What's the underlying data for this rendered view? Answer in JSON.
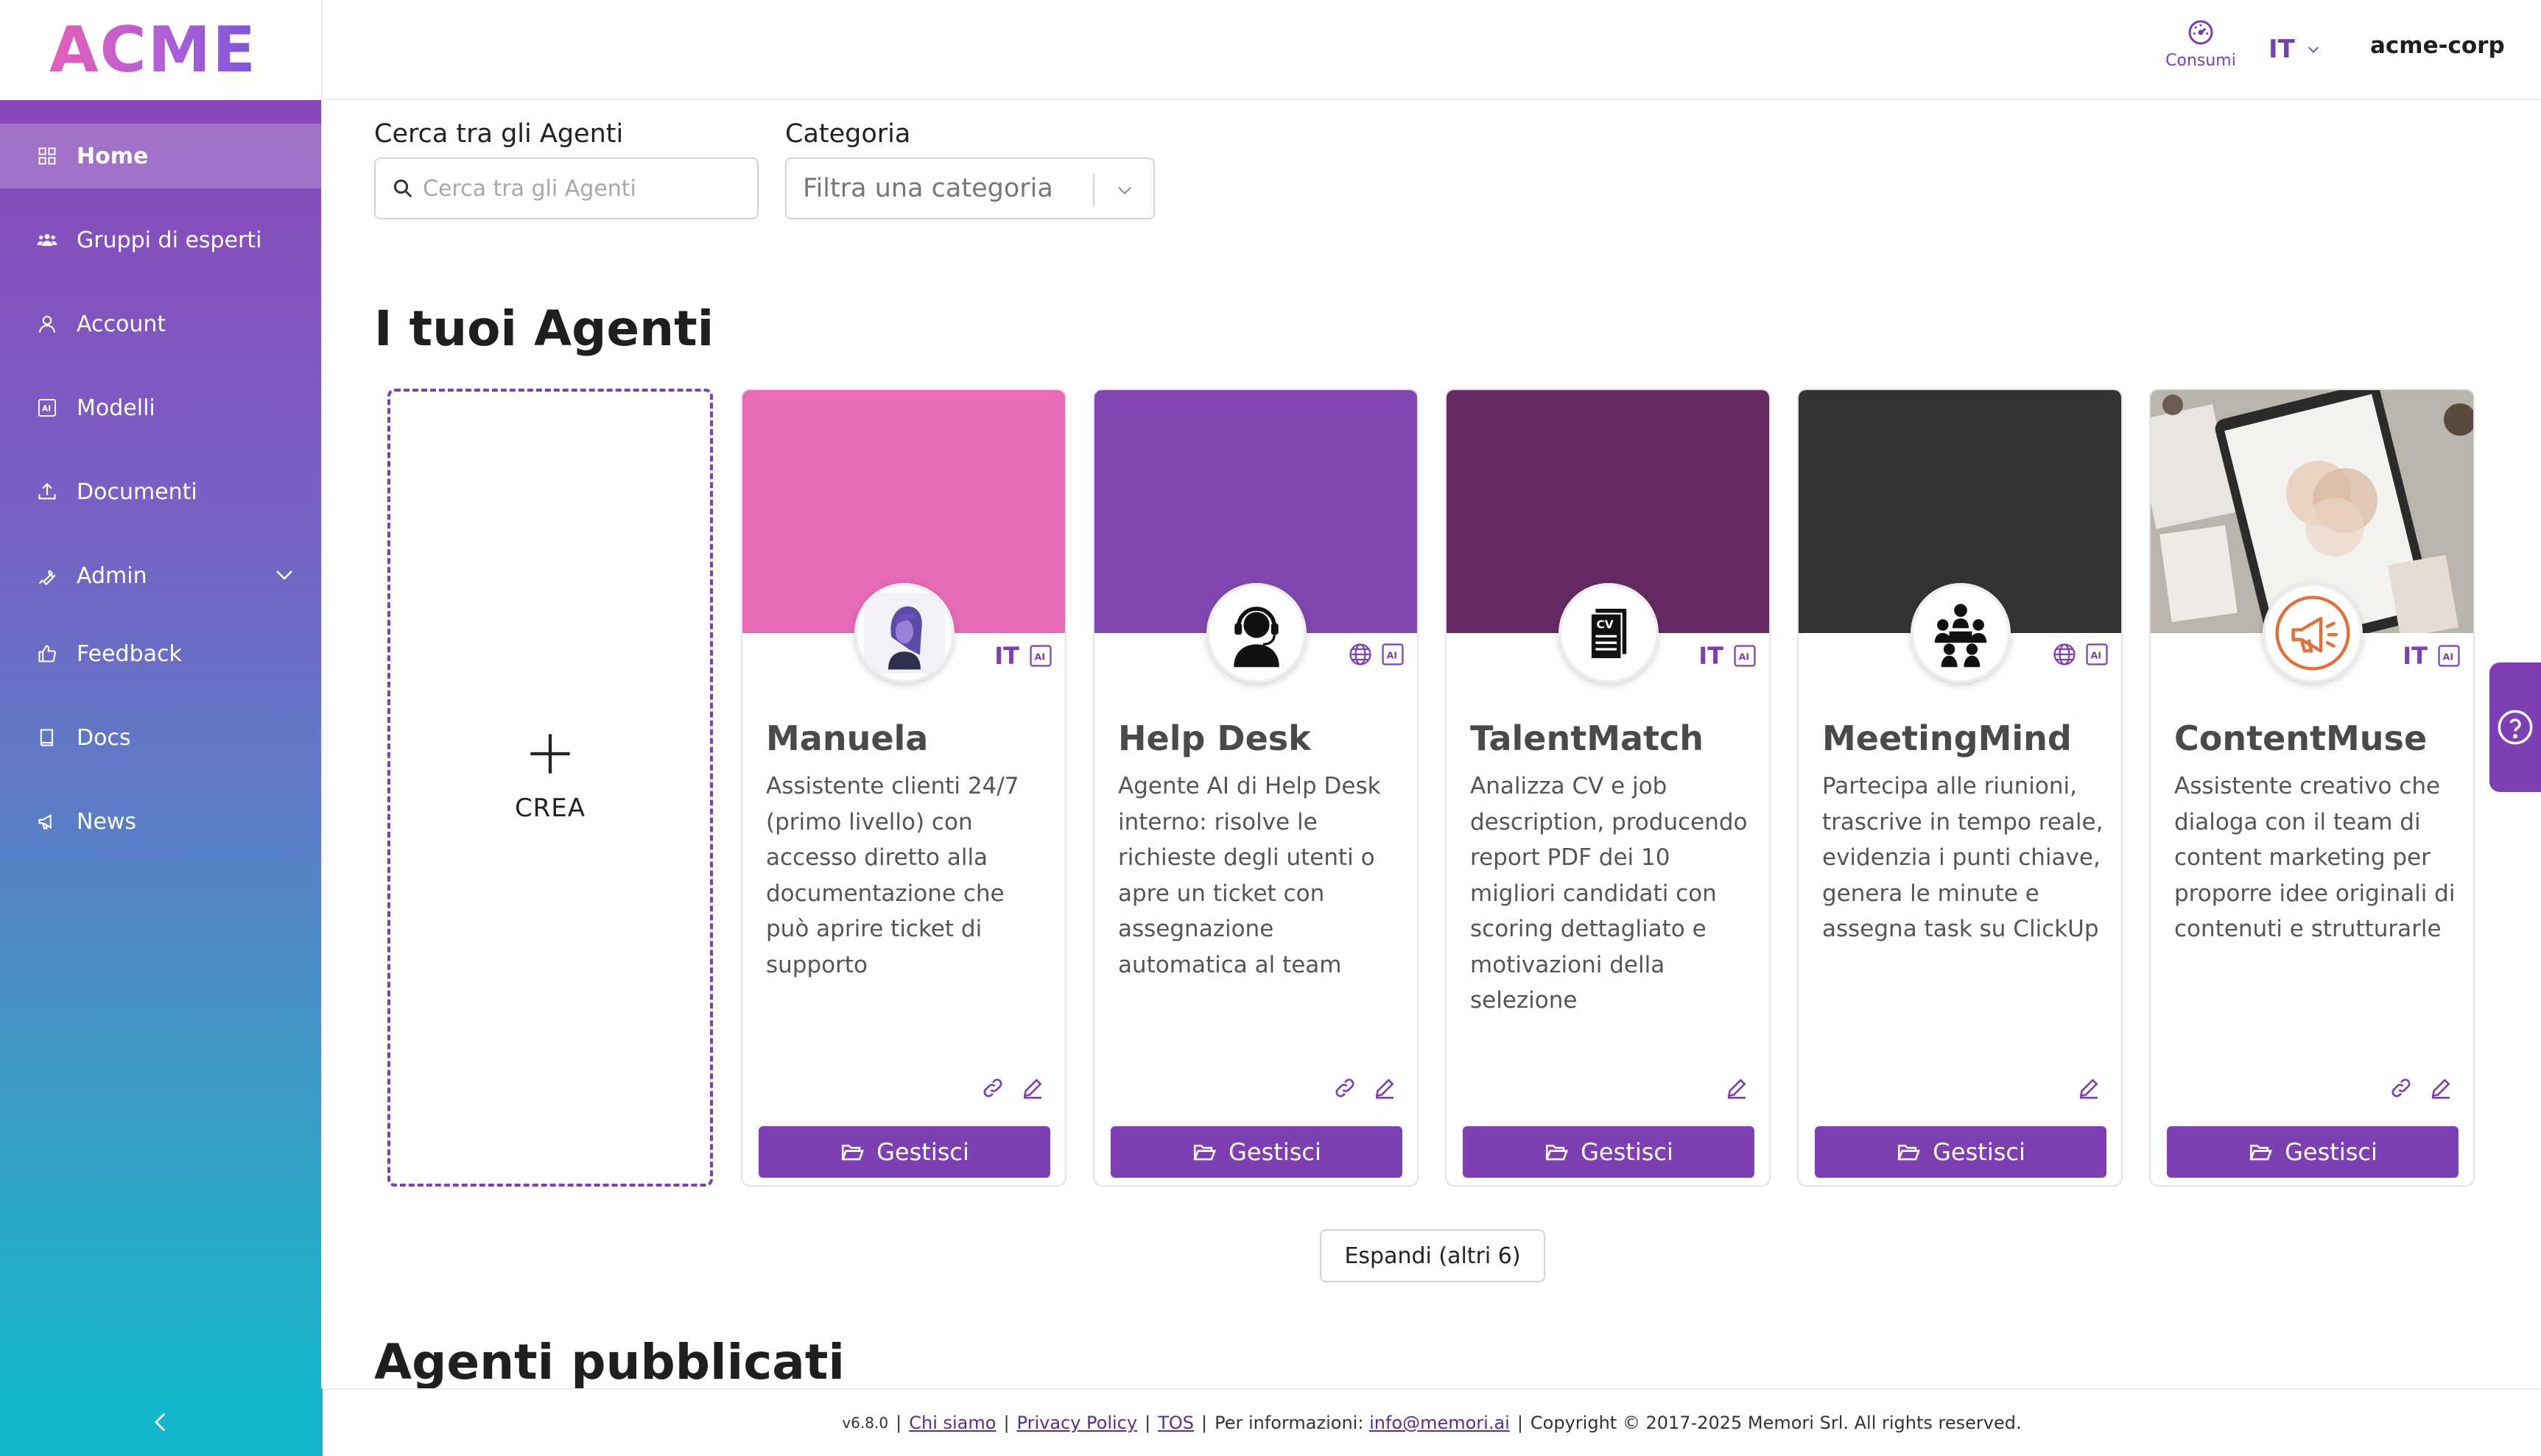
{
  "brand": {
    "logo_text": "ACME"
  },
  "header": {
    "consumi_label": "Consumi",
    "language": "IT",
    "tenant": "acme-corp"
  },
  "sidebar": {
    "items": [
      {
        "label": "Home",
        "icon": "grid-icon",
        "active": true
      },
      {
        "label": "Gruppi di esperti",
        "icon": "users-icon"
      },
      {
        "label": "Account",
        "icon": "user-icon"
      },
      {
        "label": "Modelli",
        "icon": "ai-box-icon"
      },
      {
        "label": "Documenti",
        "icon": "upload-icon"
      },
      {
        "label": "Admin",
        "icon": "wrench-icon",
        "expandable": true
      },
      {
        "label": "Feedback",
        "icon": "thumbs-up-icon"
      },
      {
        "label": "Docs",
        "icon": "book-icon"
      },
      {
        "label": "News",
        "icon": "megaphone-icon"
      }
    ],
    "collapse_icon": "chevron-left-icon"
  },
  "filters": {
    "search_label": "Cerca tra gli Agenti",
    "search_placeholder": "Cerca tra gli Agenti",
    "category_label": "Categoria",
    "category_placeholder": "Filtra una categoria"
  },
  "sections": {
    "my_agents": "I tuoi Agenti",
    "published_agents": "Agenti pubblicati"
  },
  "create_card": {
    "label": "CREA"
  },
  "agents": [
    {
      "name": "Manuela",
      "description": "Assistente clienti 24/7 (primo livello) con accesso diretto alla documentazione che può aprire ticket di supporto",
      "language": "IT",
      "cover_color": "#e76bb9",
      "avatar": "woman-avatar",
      "actions": [
        "link-icon",
        "edit-icon"
      ],
      "manage_label": "Gestisci"
    },
    {
      "name": "Help Desk",
      "description": "Agente AI di Help Desk interno: risolve le richieste degli utenti o apre un ticket con assegnazione automatica al team",
      "language": "",
      "cover_color": "#8247b0",
      "avatar": "headset-icon",
      "actions": [
        "link-icon",
        "edit-icon"
      ],
      "manage_label": "Gestisci"
    },
    {
      "name": "TalentMatch",
      "description": "Analizza CV e job description, producendo report PDF dei 10 migliori candidati con scoring dettagliato e motivazioni della selezione",
      "language": "IT",
      "cover_color": "#652a63",
      "avatar": "cv-document-icon",
      "actions": [
        "edit-icon"
      ],
      "manage_label": "Gestisci"
    },
    {
      "name": "MeetingMind",
      "description": "Partecipa alle riunioni, trascrive in tempo reale, evidenzia i punti chiave, genera le minute e assegna task su ClickUp",
      "language": "",
      "cover_color": "#333333",
      "avatar": "meeting-group-icon",
      "actions": [
        "edit-icon"
      ],
      "manage_label": "Gestisci"
    },
    {
      "name": "ContentMuse",
      "description": "Assistente creativo che dialoga con il team di content marketing per proporre idee originali di contenuti e strutturarle",
      "language": "IT",
      "cover_color": "#b9b5ad",
      "avatar": "megaphone-avatar",
      "actions": [
        "link-icon",
        "edit-icon"
      ],
      "manage_label": "Gestisci"
    }
  ],
  "expand_button": "Espandi (altri 6)",
  "footer": {
    "version": "v6.8.0",
    "about": "Chi siamo",
    "privacy": "Privacy Policy",
    "tos": "TOS",
    "info_prefix": "Per informazioni:",
    "email": "info@memori.ai",
    "copyright": "Copyright © 2017-2025 Memori Srl. All rights reserved."
  },
  "colors": {
    "accent": "#7d3fb2",
    "sidebar_top": "#8a47b8",
    "sidebar_bottom": "#15b5cc"
  }
}
